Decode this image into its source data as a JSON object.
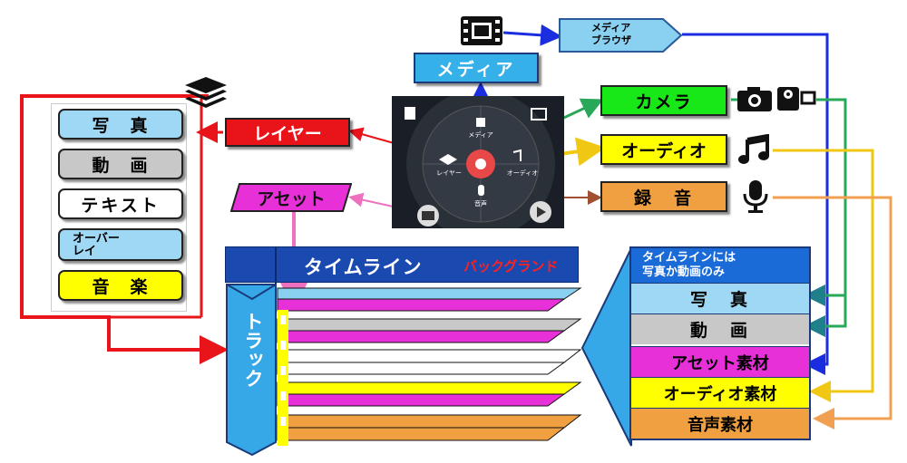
{
  "layer_list": {
    "items": [
      "写　真",
      "動　画",
      "テキスト",
      "オーバー\nレイ",
      "音　楽"
    ]
  },
  "nodes": {
    "media": "メディア",
    "media_browser": "メディア\nブラウザ",
    "layer": "レイヤー",
    "asset": "アセット",
    "camera": "カメラ",
    "audio": "オーディオ",
    "recording": "録　音"
  },
  "wheel": {
    "media": "メディア",
    "layer": "レイヤー",
    "audio": "オーディオ",
    "voice": "音声"
  },
  "timeline": {
    "title": "タイムライン",
    "background": "バックグランド",
    "track": "トラック"
  },
  "right_panel": {
    "note": "タイムラインには\n写真か動画のみ",
    "items": [
      "写　真",
      "動　画",
      "アセット素材",
      "オーディオ素材",
      "音声素材"
    ]
  },
  "colors": {
    "red": "#e8141a",
    "blue": "#1a2ee0",
    "green": "#2aa85a",
    "yellow": "#f0c814",
    "orange": "#f0a050",
    "magenta": "#e830d8",
    "sky": "#36a8e8",
    "navy": "#123a9a"
  }
}
